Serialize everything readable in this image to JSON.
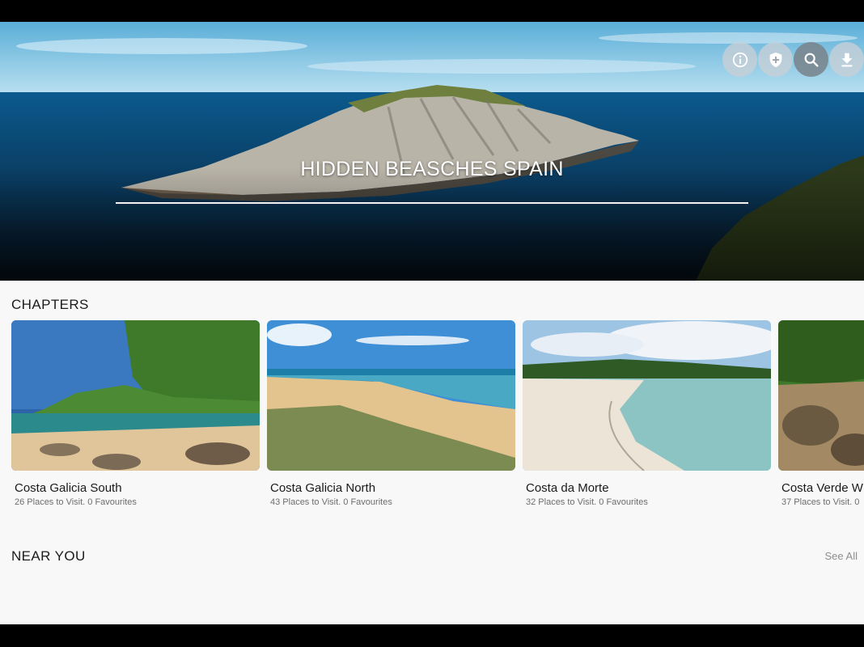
{
  "hero": {
    "title": "HIDDEN BEASCHES SPAIN",
    "actions": [
      {
        "name": "info-icon"
      },
      {
        "name": "shield-plus-icon"
      },
      {
        "name": "search-icon"
      },
      {
        "name": "download-icon"
      }
    ]
  },
  "chapters": {
    "title": "CHAPTERS",
    "cards": [
      {
        "name": "Costa Galicia South",
        "meta": "26 Places to Visit. 0 Favourites"
      },
      {
        "name": "Costa Galicia North",
        "meta": "43 Places to Visit. 0 Favourites"
      },
      {
        "name": "Costa da Morte",
        "meta": "32 Places to Visit. 0 Favourites"
      },
      {
        "name": "Costa Verde W",
        "meta": "37 Places to Visit. 0"
      }
    ]
  },
  "near_you": {
    "title": "NEAR YOU",
    "see_all": "See All"
  }
}
